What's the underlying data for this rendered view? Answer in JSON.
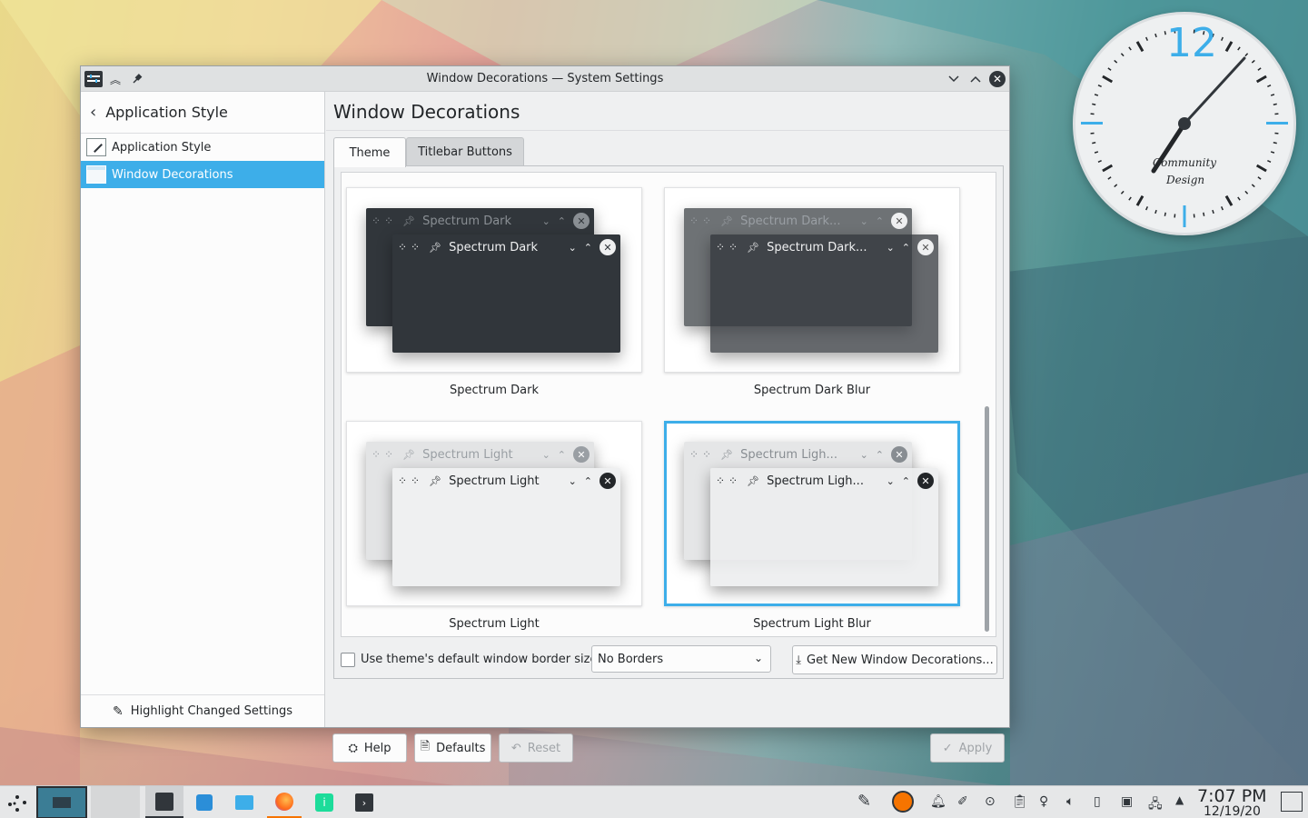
{
  "window": {
    "title": "Window Decorations — System Settings"
  },
  "sidebar": {
    "back_label": "Application Style",
    "items": [
      {
        "label": "Application Style"
      },
      {
        "label": "Window Decorations"
      }
    ],
    "highlight_button": "Highlight Changed Settings"
  },
  "main": {
    "title": "Window Decorations",
    "tabs": [
      {
        "label": "Theme"
      },
      {
        "label": "Titlebar Buttons"
      }
    ],
    "themes": [
      {
        "name": "Spectrum Dark",
        "preview_title": "Spectrum Dark"
      },
      {
        "name": "Spectrum Dark Blur",
        "preview_title": "Spectrum Dark..."
      },
      {
        "name": "Spectrum Light",
        "preview_title": "Spectrum Light"
      },
      {
        "name": "Spectrum Light Blur",
        "preview_title": "Spectrum Ligh..."
      }
    ],
    "selected_theme": "Spectrum Light Blur",
    "border_checkbox_label": "Use theme's default window border size",
    "border_checkbox_checked": false,
    "border_size_value": "No Borders",
    "get_new_label": "Get New Window Decorations..."
  },
  "buttons": {
    "help": "Help",
    "defaults": "Defaults",
    "reset": "Reset",
    "apply": "Apply"
  },
  "clock": {
    "hour_label": "12",
    "brand_line1": "Community",
    "brand_line2": "Design"
  },
  "taskbar": {
    "time": "7:07 PM",
    "date": "12/19/20"
  },
  "colors": {
    "accent": "#3daee9",
    "window_bg": "#eff0f1",
    "dark_theme": "#31363b"
  }
}
